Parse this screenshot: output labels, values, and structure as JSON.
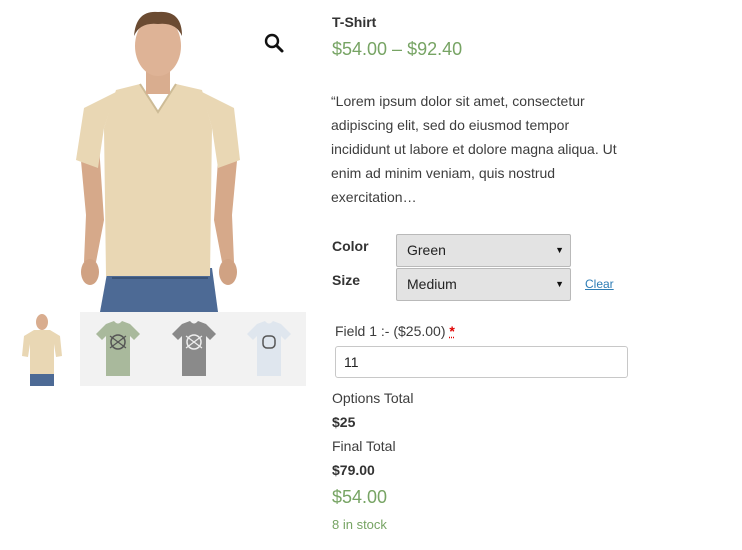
{
  "product": {
    "title": "T-Shirt",
    "price_range": "$54.00 – $92.40",
    "description": "“Lorem ipsum dolor sit amet, consectetur adipiscing elit, sed do eiusmod tempor incididunt ut labore et dolore magna aliqua. Ut enim ad minim veniam, quis nostrud exercitation…"
  },
  "gallery": {
    "zoom_icon": "search-icon",
    "shirt_colors": {
      "main": "#e9d7b4",
      "thumb_green": "#a9b99c",
      "thumb_gray": "#8a8a8a",
      "thumb_white": "#dfe6ee"
    }
  },
  "variations": {
    "color": {
      "label": "Color",
      "selected": "Green"
    },
    "size": {
      "label": "Size",
      "selected": "Medium"
    },
    "clear_label": "Clear"
  },
  "addon_field": {
    "label": "Field 1 :- ($25.00)",
    "required_mark": "*",
    "value": "11"
  },
  "totals": {
    "options_label": "Options Total",
    "options_value": "$25",
    "final_label": "Final Total",
    "final_value": "$79.00"
  },
  "price": "$54.00",
  "stock": "8 in stock",
  "colors": {
    "price_green": "#77a464",
    "link_blue": "#2e7db5",
    "required_red": "#e00000"
  }
}
